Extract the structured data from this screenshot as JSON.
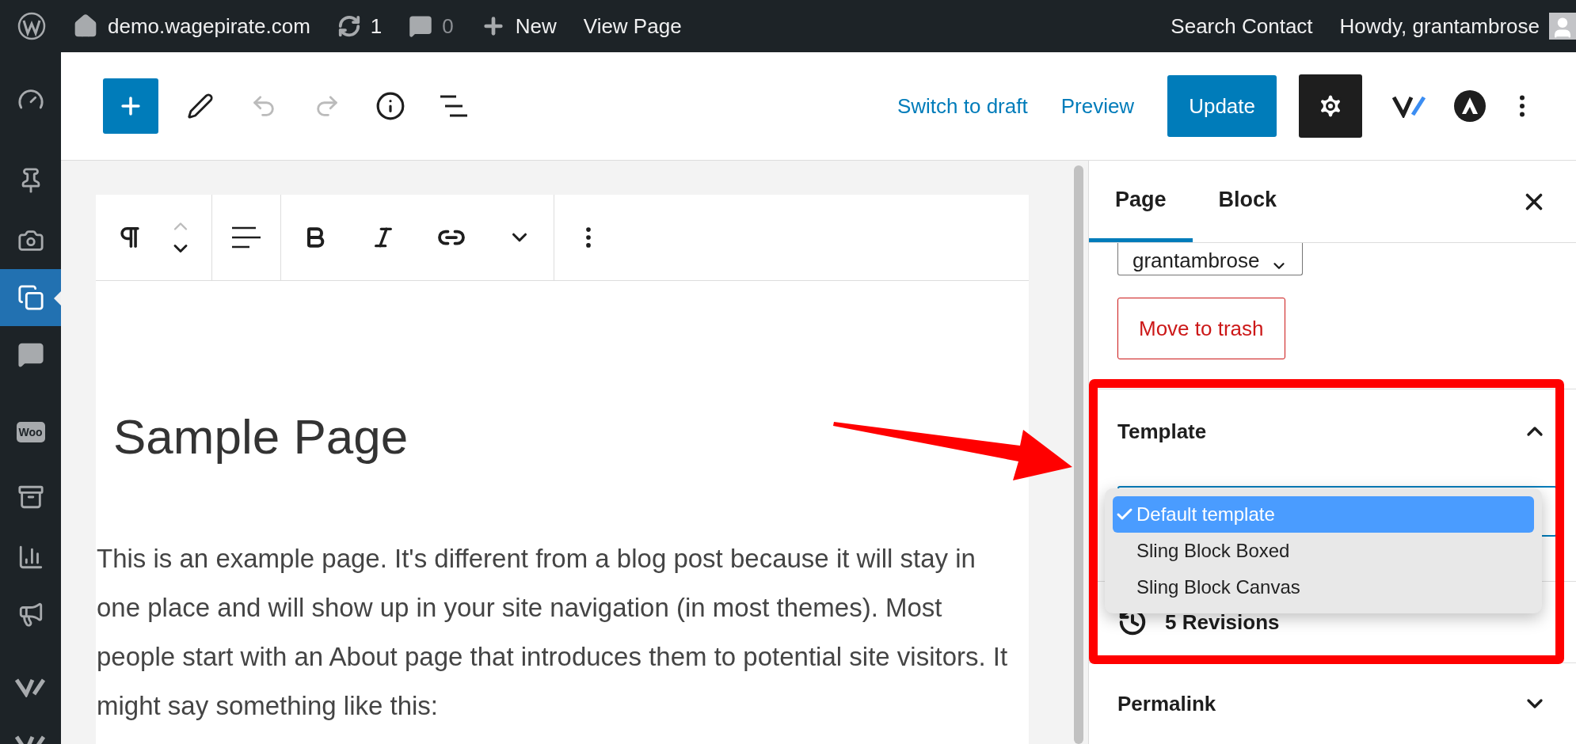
{
  "admin_bar": {
    "site": "demo.wagepirate.com",
    "updates": "1",
    "comments": "0",
    "new": "New",
    "view": "View Page",
    "search": "Search Contact",
    "howdy": "Howdy, grantambrose"
  },
  "admin_menu": [
    {
      "selected": false
    },
    {
      "selected": false
    },
    {
      "selected": false
    },
    {
      "selected": true
    },
    {
      "selected": false
    },
    {
      "selected": false,
      "label": "Woo"
    },
    {
      "selected": false
    },
    {
      "selected": false
    },
    {
      "selected": false
    },
    {
      "selected": false
    },
    {
      "selected": false
    }
  ],
  "editor_header": {
    "undo_disabled": true,
    "redo_disabled": true,
    "switch_to_draft": "Switch to draft",
    "preview": "Preview",
    "update": "Update",
    "settings_active": true
  },
  "block_toolbar": {
    "move_up_disabled": true
  },
  "content": {
    "title": "Sample Page",
    "paragraph": "This is an example page. It's different from a blog post because it will stay in one place and will show up in your site navigation (in most themes). Most people start with an About page that introduces them to potential site visitors. It might say something like this:"
  },
  "sidebar": {
    "tabs": [
      {
        "label": "Page",
        "selected": true
      },
      {
        "label": "Block",
        "selected": false
      }
    ],
    "author": "grantambrose",
    "trash": "Move to trash",
    "template": {
      "title": "Template",
      "expanded": true,
      "options": [
        {
          "label": "Default template",
          "selected": true
        },
        {
          "label": "Sling Block Boxed",
          "selected": false
        },
        {
          "label": "Sling Block Canvas",
          "selected": false
        }
      ]
    },
    "revisions": "5 Revisions",
    "permalink": {
      "title": "Permalink",
      "expanded": false
    }
  }
}
